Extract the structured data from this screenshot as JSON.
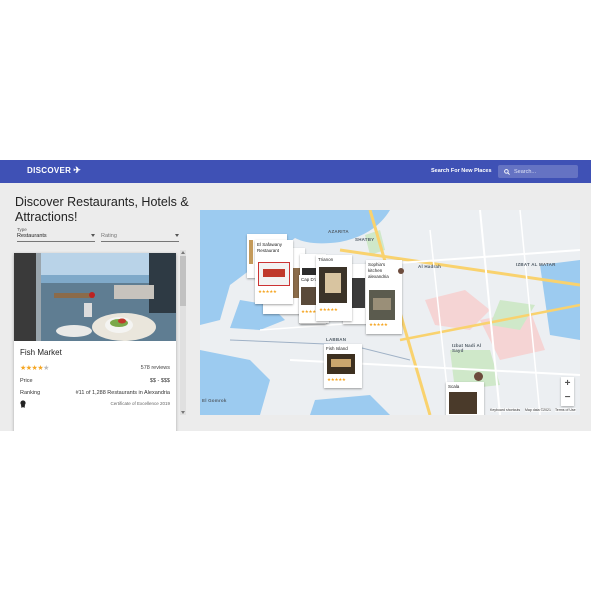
{
  "header": {
    "brand": "DISCOVER",
    "search_label": "Search For New Places",
    "search_placeholder": "Search..."
  },
  "main": {
    "title": "Discover Restaurants, Hotels & Attractions!",
    "type_label": "Type",
    "type_value": "Restaurants",
    "rating_label": "Rating"
  },
  "card": {
    "name": "Fish Market",
    "rating": 4,
    "rating_stars": "★★★★",
    "rating_stars_off": "★",
    "reviews": "578 reviews",
    "price_label": "Price",
    "price_value": "$$ - $$$",
    "ranking_label": "Ranking",
    "ranking_value": "#11 of 1,288 Restaurants in Alexandria",
    "certificate": "Certificate of Excellence 2019"
  },
  "map": {
    "area_labels": [
      "SHATBY",
      "AZARITA",
      "Al Hadrah",
      "IZBAT AL MATAR",
      "LABBAN",
      "Izbat Nadi Al Sayd",
      "El Gomrok"
    ],
    "markers": [
      {
        "name": "El Safawany Restaurant"
      },
      {
        "name": "Trianon"
      },
      {
        "name": "Sophia's kitchen alexandria"
      },
      {
        "name": "Fish Island"
      },
      {
        "name": "Scala"
      },
      {
        "name": "Cap D'or"
      }
    ],
    "zoom_in": "+",
    "zoom_out": "−",
    "attribution_shortcuts": "Keyboard shortcuts",
    "attribution_data": "Map data ©2021",
    "attribution_terms": "Terms of Use",
    "stars": "★★★★★"
  },
  "colors": {
    "primary": "#3f51b5",
    "star": "#f5a623",
    "water": "#9ccbf0"
  }
}
